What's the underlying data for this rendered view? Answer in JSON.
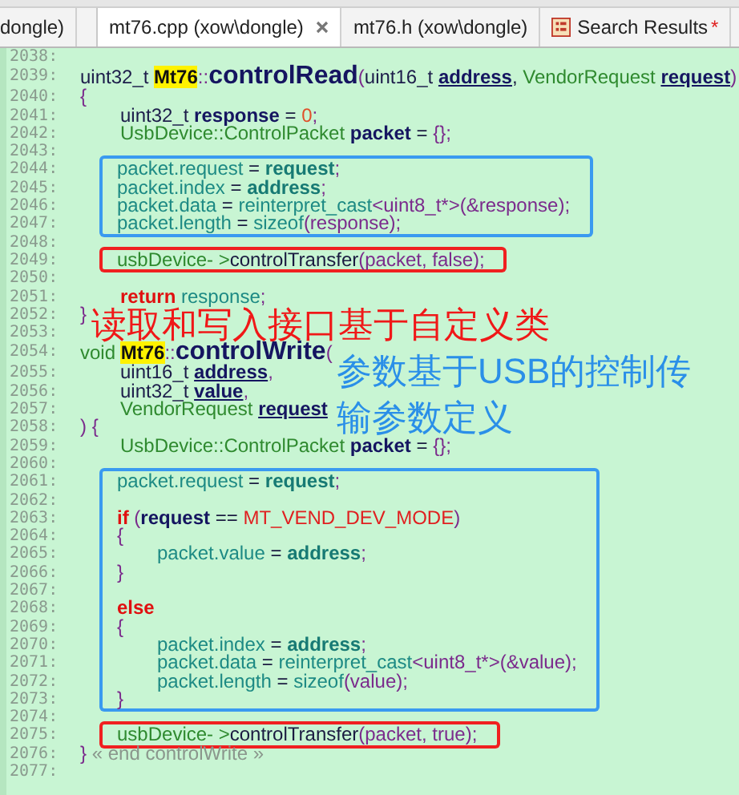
{
  "tabs": [
    {
      "label": "dongle)",
      "selected": false
    },
    {
      "label": "mt76.cpp (xow\\dongle)",
      "selected": true,
      "closable": true
    },
    {
      "label": "mt76.h (xow\\dongle)",
      "selected": false
    },
    {
      "label": "Search Results",
      "selected": false,
      "icon": true,
      "modified": "*"
    }
  ],
  "editor": {
    "lines": [
      {
        "number": "2038:"
      },
      {
        "number": "2039:",
        "tokens": [
          {
            "text": "uint32_t ",
            "kind": "type"
          },
          {
            "text": "Mt76",
            "kind": "hl"
          },
          {
            "text": "::",
            "kind": "punct"
          },
          {
            "text": "controlRead",
            "kind": "fn"
          },
          {
            "text": "(",
            "kind": "punct"
          },
          {
            "text": "uint16_t ",
            "kind": "type"
          },
          {
            "text": "address",
            "kind": "param"
          },
          {
            "text": ", ",
            "kind": "plain"
          },
          {
            "text": "VendorRequest ",
            "kind": "cls"
          },
          {
            "text": "request",
            "kind": "param"
          },
          {
            "text": ")",
            "kind": "punct"
          }
        ]
      },
      {
        "number": "2040:",
        "tokens": [
          {
            "text": "{",
            "kind": "punct"
          }
        ],
        "children": [
          {
            "number": "2041:",
            "tokens": [
              {
                "text": "uint32_t ",
                "kind": "type"
              },
              {
                "text": "response",
                "kind": "decl"
              },
              {
                "text": " = ",
                "kind": "plain"
              },
              {
                "text": "0",
                "kind": "num"
              },
              {
                "text": ";",
                "kind": "punct"
              }
            ]
          },
          {
            "number": "2042:",
            "tokens": [
              {
                "text": "UsbDevice::ControlPacket ",
                "kind": "cls"
              },
              {
                "text": "packet",
                "kind": "decl"
              },
              {
                "text": " = ",
                "kind": "plain"
              },
              {
                "text": "{};",
                "kind": "punct"
              }
            ]
          },
          {
            "number": "2043:"
          },
          {
            "kind": "box",
            "color": "#3a9af0",
            "lines": [
              {
                "number": "2044:",
                "tokens": [
                  {
                    "text": "packet.request",
                    "kind": "var"
                  },
                  {
                    "text": " = ",
                    "kind": "plain"
                  },
                  {
                    "text": "request",
                    "kind": "varb"
                  },
                  {
                    "text": ";",
                    "kind": "punct"
                  }
                ]
              },
              {
                "number": "2045:",
                "tokens": [
                  {
                    "text": "packet.index",
                    "kind": "var"
                  },
                  {
                    "text": " = ",
                    "kind": "plain"
                  },
                  {
                    "text": "address",
                    "kind": "varb"
                  },
                  {
                    "text": ";",
                    "kind": "punct"
                  }
                ]
              },
              {
                "number": "2046:",
                "tokens": [
                  {
                    "text": "packet.data",
                    "kind": "var"
                  },
                  {
                    "text": " = ",
                    "kind": "plain"
                  },
                  {
                    "text": "reinterpret_cast",
                    "kind": "var"
                  },
                  {
                    "text": "<uint8_t*>",
                    "kind": "punct"
                  },
                  {
                    "text": "(&response);",
                    "kind": "punct"
                  }
                ]
              },
              {
                "number": "2047:",
                "tokens": [
                  {
                    "text": "packet.length",
                    "kind": "var"
                  },
                  {
                    "text": " = ",
                    "kind": "plain"
                  },
                  {
                    "text": "sizeof",
                    "kind": "var"
                  },
                  {
                    "text": "(response);",
                    "kind": "punct"
                  }
                ]
              }
            ]
          },
          {
            "number": "2048:"
          },
          {
            "kind": "box",
            "color": "#f02020",
            "lines": [
              {
                "number": "2049:",
                "tokens": [
                  {
                    "text": "usbDevice- >",
                    "kind": "cls"
                  },
                  {
                    "text": "controlTransfer",
                    "kind": "plain"
                  },
                  {
                    "text": "(packet, false);",
                    "kind": "punct"
                  }
                ]
              }
            ]
          },
          {
            "number": "2050:"
          },
          {
            "number": "2051:",
            "tokens": [
              {
                "text": "return ",
                "kind": "kw"
              },
              {
                "text": "response",
                "kind": "var"
              },
              {
                "text": ";",
                "kind": "punct"
              }
            ]
          }
        ]
      },
      {
        "number": "2052:",
        "tokens": [
          {
            "text": "}",
            "kind": "punct"
          }
        ]
      },
      {
        "number": "2053:"
      },
      {
        "number": "2054:",
        "tokens": [
          {
            "text": "void ",
            "kind": "cls"
          },
          {
            "text": "Mt76",
            "kind": "hl"
          },
          {
            "text": "::",
            "kind": "punct"
          },
          {
            "text": "controlWrite",
            "kind": "fn"
          },
          {
            "text": "(",
            "kind": "punct"
          }
        ],
        "children": [
          {
            "number": "2055:",
            "tokens": [
              {
                "text": "uint16_t ",
                "kind": "type"
              },
              {
                "text": "address",
                "kind": "param"
              },
              {
                "text": ",",
                "kind": "punct"
              }
            ]
          },
          {
            "number": "2056:",
            "tokens": [
              {
                "text": "uint32_t ",
                "kind": "type"
              },
              {
                "text": "value",
                "kind": "param"
              },
              {
                "text": ",",
                "kind": "punct"
              }
            ]
          },
          {
            "number": "2057:",
            "tokens": [
              {
                "text": "VendorRequest ",
                "kind": "cls"
              },
              {
                "text": "request",
                "kind": "param"
              }
            ]
          }
        ]
      },
      {
        "number": "2058:",
        "tokens": [
          {
            "text": ") {",
            "kind": "punct"
          }
        ],
        "children": [
          {
            "number": "2059:",
            "tokens": [
              {
                "text": "UsbDevice::ControlPacket ",
                "kind": "cls"
              },
              {
                "text": "packet",
                "kind": "decl"
              },
              {
                "text": " = ",
                "kind": "plain"
              },
              {
                "text": "{};",
                "kind": "punct"
              }
            ]
          },
          {
            "number": "2060:"
          },
          {
            "kind": "box",
            "color": "#3a9af0",
            "lines": [
              {
                "number": "2061:",
                "tokens": [
                  {
                    "text": "packet.request",
                    "kind": "var"
                  },
                  {
                    "text": " = ",
                    "kind": "plain"
                  },
                  {
                    "text": "request",
                    "kind": "varb"
                  },
                  {
                    "text": ";",
                    "kind": "punct"
                  }
                ]
              },
              {
                "number": "2062:"
              },
              {
                "number": "2063:",
                "tokens": [
                  {
                    "text": "if ",
                    "kind": "kw"
                  },
                  {
                    "text": "(",
                    "kind": "punct"
                  },
                  {
                    "text": "request",
                    "kind": "decl"
                  },
                  {
                    "text": " == ",
                    "kind": "plain"
                  },
                  {
                    "text": "MT_VEND_DEV_MODE",
                    "kind": "const"
                  },
                  {
                    "text": ")",
                    "kind": "punct"
                  }
                ]
              },
              {
                "number": "2064:",
                "tokens": [
                  {
                    "text": "{",
                    "kind": "punct"
                  }
                ],
                "children": [
                  {
                    "number": "2065:",
                    "tokens": [
                      {
                        "text": "packet.value",
                        "kind": "var"
                      },
                      {
                        "text": " = ",
                        "kind": "plain"
                      },
                      {
                        "text": "address",
                        "kind": "varb"
                      },
                      {
                        "text": ";",
                        "kind": "punct"
                      }
                    ]
                  }
                ]
              },
              {
                "number": "2066:",
                "tokens": [
                  {
                    "text": "}",
                    "kind": "punct"
                  }
                ]
              },
              {
                "number": "2067:"
              },
              {
                "number": "2068:",
                "tokens": [
                  {
                    "text": "else",
                    "kind": "kw"
                  }
                ]
              },
              {
                "number": "2069:",
                "tokens": [
                  {
                    "text": "{",
                    "kind": "punct"
                  }
                ],
                "children": [
                  {
                    "number": "2070:",
                    "tokens": [
                      {
                        "text": "packet.index",
                        "kind": "var"
                      },
                      {
                        "text": " = ",
                        "kind": "plain"
                      },
                      {
                        "text": "address",
                        "kind": "varb"
                      },
                      {
                        "text": ";",
                        "kind": "punct"
                      }
                    ]
                  },
                  {
                    "number": "2071:",
                    "tokens": [
                      {
                        "text": "packet.data",
                        "kind": "var"
                      },
                      {
                        "text": " = ",
                        "kind": "plain"
                      },
                      {
                        "text": "reinterpret_cast",
                        "kind": "var"
                      },
                      {
                        "text": "<uint8_t*>",
                        "kind": "punct"
                      },
                      {
                        "text": "(&value);",
                        "kind": "punct"
                      }
                    ]
                  },
                  {
                    "number": "2072:",
                    "tokens": [
                      {
                        "text": "packet.length",
                        "kind": "var"
                      },
                      {
                        "text": " = ",
                        "kind": "plain"
                      },
                      {
                        "text": "sizeof",
                        "kind": "var"
                      },
                      {
                        "text": "(value);",
                        "kind": "punct"
                      }
                    ]
                  }
                ]
              },
              {
                "number": "2073:",
                "tokens": [
                  {
                    "text": "}",
                    "kind": "punct"
                  }
                ]
              }
            ]
          },
          {
            "number": "2074:"
          },
          {
            "kind": "box",
            "color": "#f02020",
            "lines": [
              {
                "number": "2075:",
                "tokens": [
                  {
                    "text": "usbDevice- >",
                    "kind": "cls"
                  },
                  {
                    "text": "controlTransfer",
                    "kind": "plain"
                  },
                  {
                    "text": "(packet, true);",
                    "kind": "punct"
                  }
                ]
              }
            ]
          }
        ]
      },
      {
        "number": "2076:",
        "tokens": [
          {
            "text": "}",
            "kind": "punct"
          },
          {
            "text": " « end controlWrite »",
            "kind": "comment"
          }
        ]
      },
      {
        "number": "2077:"
      }
    ]
  },
  "annotations": [
    {
      "text": "读取和写入接口基于自定义类",
      "color": "#f01818"
    },
    {
      "text": "参数基于USB的控制传输参数定义",
      "color": "#2a8fe8"
    }
  ]
}
